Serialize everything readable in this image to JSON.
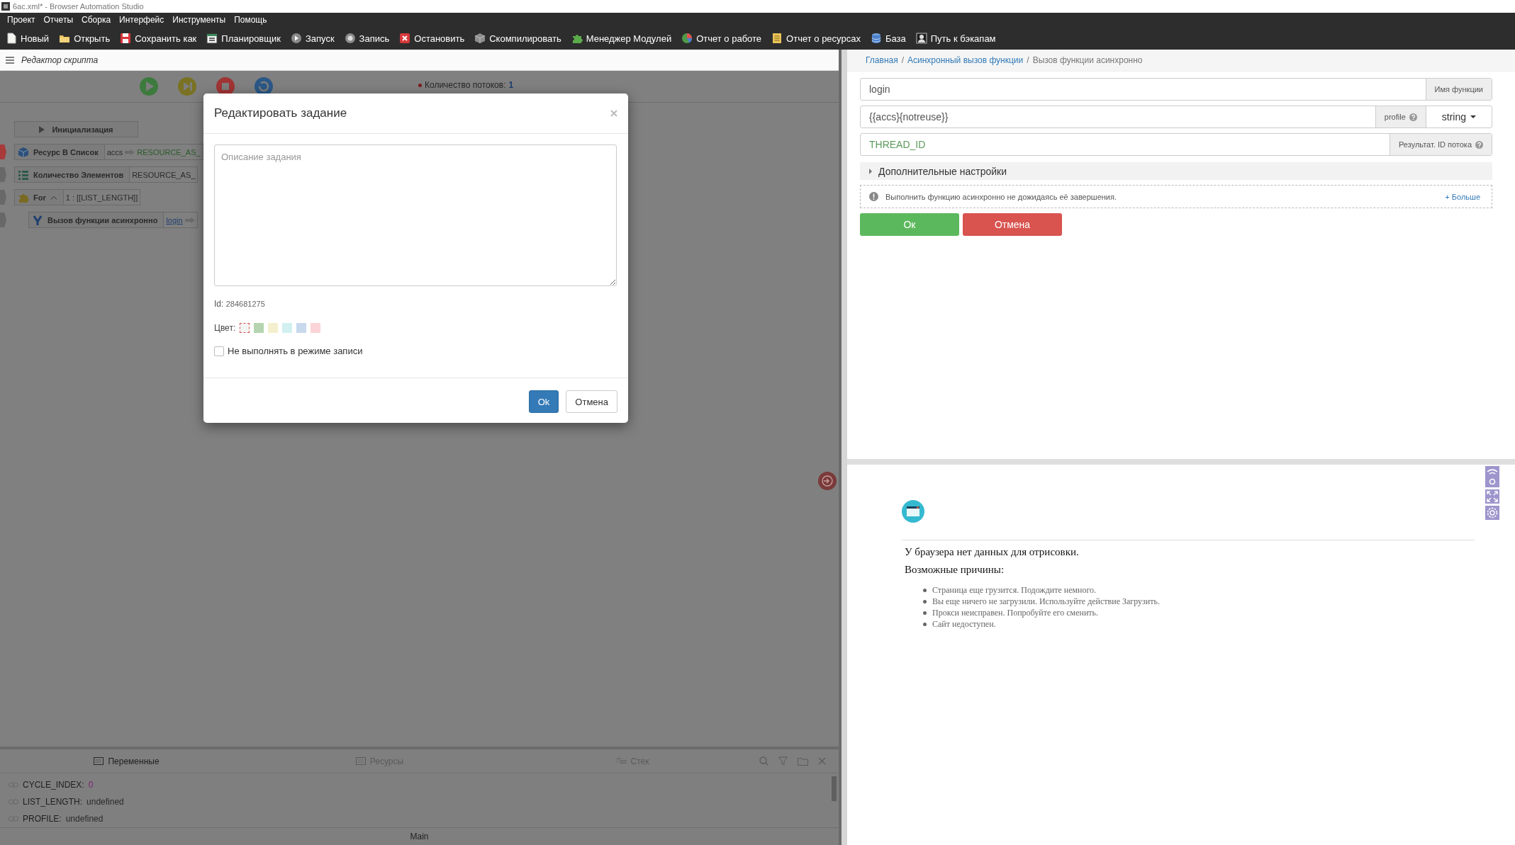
{
  "window": {
    "title": "6ac.xml* - Browser Automation Studio"
  },
  "menu": [
    "Проект",
    "Отчеты",
    "Сборка",
    "Интерфейс",
    "Инструменты",
    "Помощь"
  ],
  "toolbar": [
    "Новый",
    "Открыть",
    "Сохранить как",
    "Планировщик",
    "Запуск",
    "Запись",
    "Остановить",
    "Скомпилировать",
    "Менеджер Модулей",
    "Отчет о работе",
    "Отчет о ресурсах",
    "База",
    "Путь к бэкапам"
  ],
  "editor": {
    "title": "Редактор скрипта",
    "thread_count_label": "Количество потоков:",
    "thread_count": "1",
    "init_block": "Инициализация",
    "actions": [
      {
        "name": "Ресурс В Список",
        "input": "accs",
        "output": "RESOURCE_AS_",
        "color": "#a83a3a"
      },
      {
        "name": "Количество Элементов",
        "input": "RESOURCE_AS_",
        "color": "#686868"
      },
      {
        "name": "For",
        "input": "1 : [[LIST_LENGTH]]",
        "color": "#686868",
        "expanded": true,
        "children": [
          {
            "name": "Вызов функции асинхронно",
            "input": "login",
            "color": "#686868"
          }
        ]
      }
    ]
  },
  "dialog": {
    "title": "Редактировать задание",
    "description_placeholder": "Описание задания",
    "id_label": "Id:",
    "id": "284681275",
    "color_label": "Цвет:",
    "colors": [
      {
        "color": "#f4f4f4",
        "selected": true
      },
      {
        "color": "#b5d4b0",
        "selected": false
      },
      {
        "color": "#f4efcc",
        "selected": false
      },
      {
        "color": "#d2f0f0",
        "selected": false
      },
      {
        "color": "#c8d9ee",
        "selected": false
      },
      {
        "color": "#fad4d6",
        "selected": false
      }
    ],
    "skip_in_record": {
      "label": "Не выполнять в режиме записи",
      "checked": false
    },
    "buttons": [
      "Ok",
      "Отмена"
    ]
  },
  "debug": {
    "tabs": [
      {
        "label": "Переменные",
        "selected": true
      },
      {
        "label": "Ресурсы",
        "selected": false
      },
      {
        "label": "Стек",
        "selected": false
      }
    ],
    "variables": [
      {
        "name": "CYCLE_INDEX:",
        "value": "0",
        "kind": "number"
      },
      {
        "name": "LIST_LENGTH:",
        "value": "undefined",
        "kind": "undefined"
      },
      {
        "name": "PROFILE:",
        "value": "undefined",
        "kind": "undefined"
      }
    ],
    "status": "Main"
  },
  "action_form": {
    "breadcrumb_separator": "/",
    "breadcrumb": [
      "Главная",
      "Асинхронный вызов функции",
      "Вызов функции асинхронно"
    ],
    "fields": [
      {
        "value": "login",
        "kind": "text",
        "addon": "Имя функции",
        "help": false
      },
      {
        "value": "{{accs}{notreuse}}",
        "kind": "text",
        "addon": "profile",
        "help": true,
        "type": "string"
      },
      {
        "value": "THREAD_ID",
        "kind": "variable",
        "addon": "Результат. ID потока",
        "help": true
      }
    ],
    "advanced": {
      "label": "Дополнительные настройки",
      "expanded": false
    },
    "info": {
      "text": "Выполнить функцию асинхронно не дожидаясь её завершения.",
      "more": "+ Больше"
    },
    "buttons": [
      "Ок",
      "Отмена"
    ]
  },
  "browser": {
    "message": "У браузера нет данных для отрисовки.",
    "reasons_title": "Возможные причины:",
    "reasons": [
      "Страница еще грузится. Подождите немного.",
      "Вы еще ничего не загрузили. Используйте действие Загрузить.",
      "Прокси неисправен. Попробуйте его сменить.",
      "Сайт недоступен."
    ]
  }
}
